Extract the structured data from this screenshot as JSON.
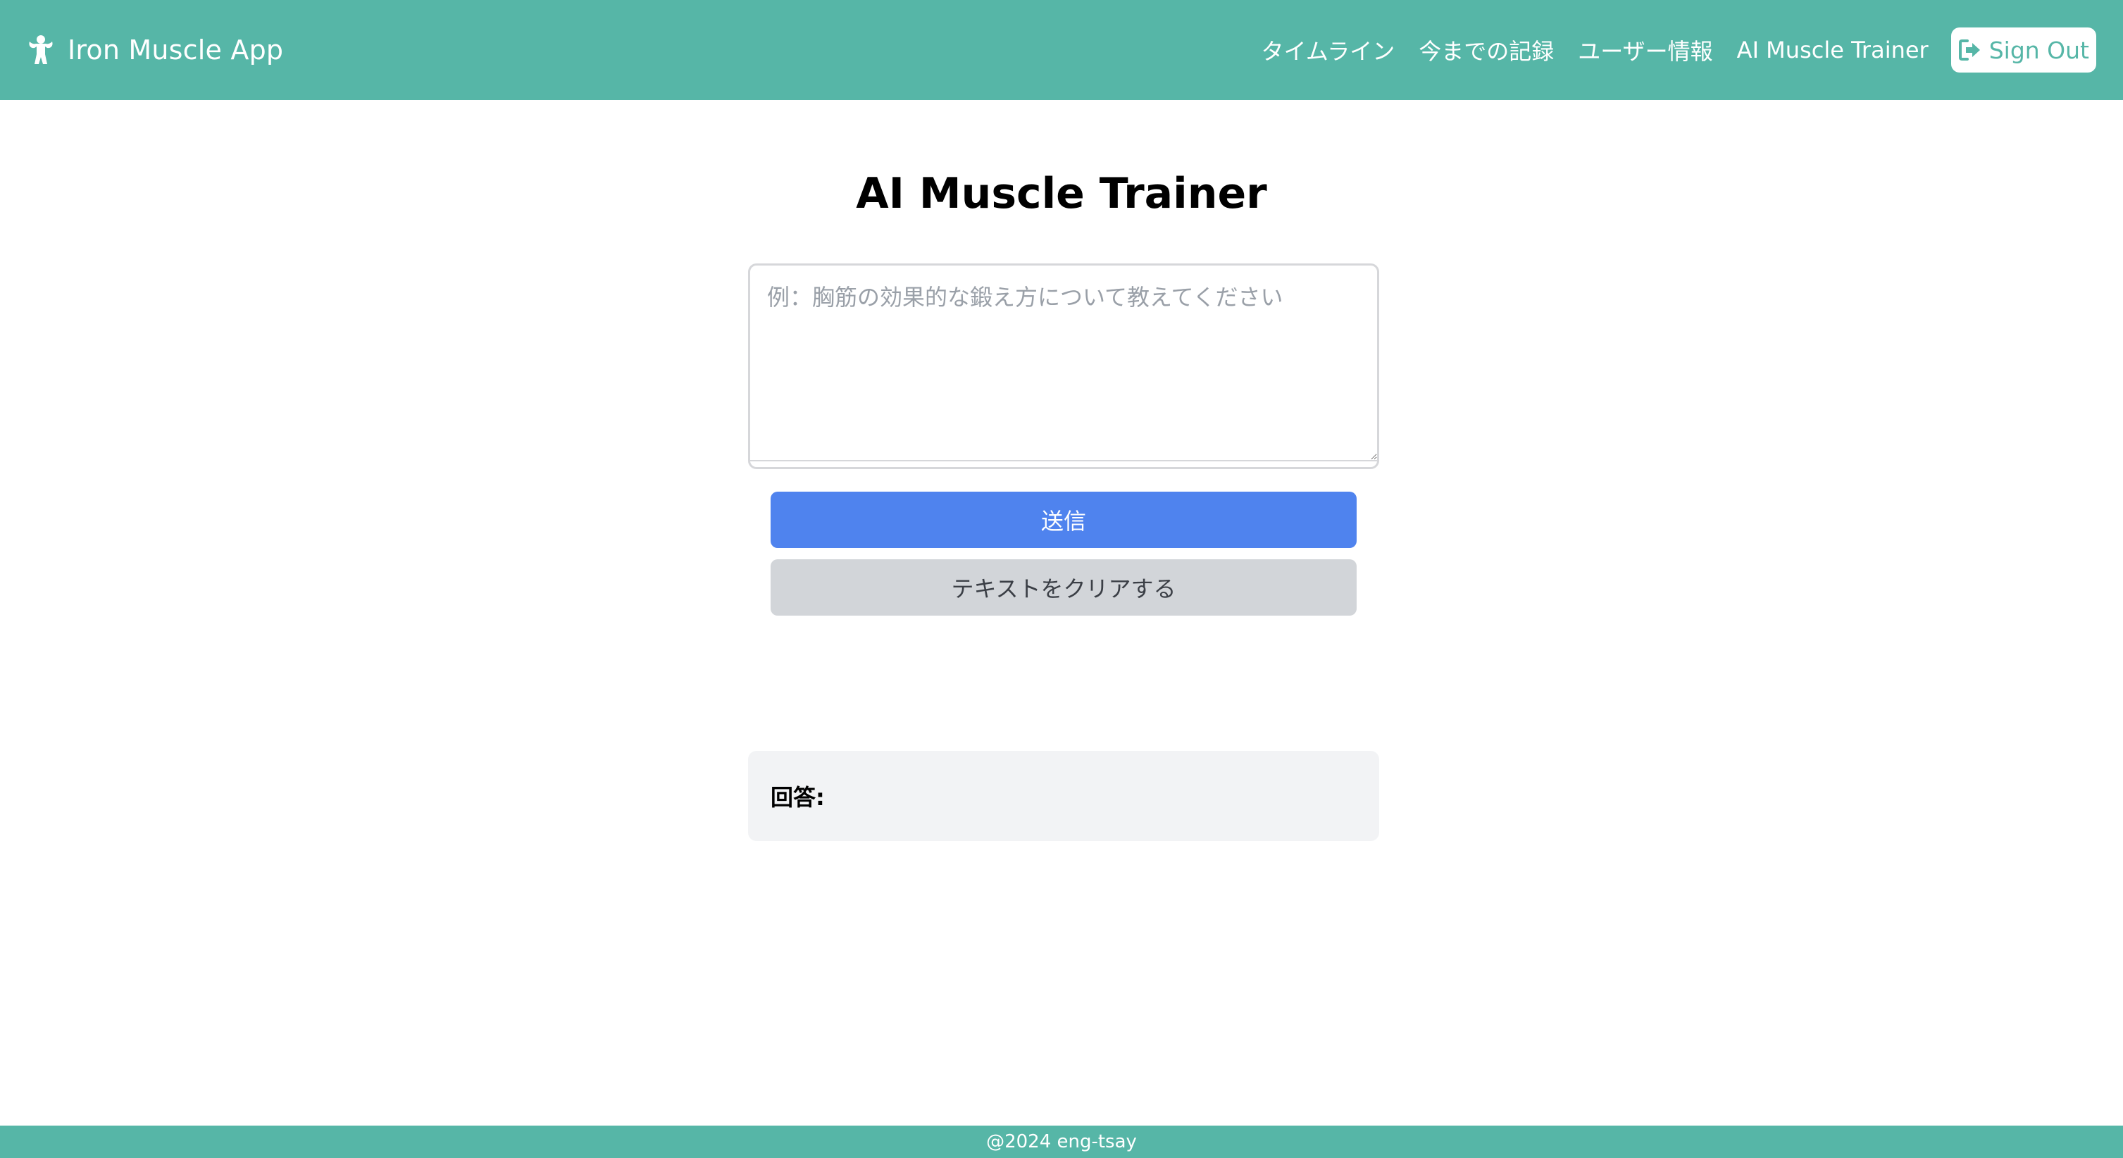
{
  "navbar": {
    "brand_icon": "flexed-arm-muscle-icon",
    "brand_text": "Iron Muscle App",
    "links": [
      "タイムライン",
      "今までの記録",
      "ユーザー情報",
      "AI Muscle Trainer"
    ],
    "signout_icon": "sign-out-icon",
    "signout_label": "Sign Out",
    "color": "#56b6a7"
  },
  "main": {
    "title": "AI Muscle Trainer",
    "question_placeholder": "例：胸筋の効果的な鍛え方について教えてください",
    "question_value": "",
    "send_label": "送信",
    "clear_label": "テキストをクリアする",
    "answer_label": "回答:",
    "send_color": "#4f83ee",
    "clear_color": "#d2d5d9"
  },
  "footer": {
    "text": "@2024 eng-tsay"
  }
}
